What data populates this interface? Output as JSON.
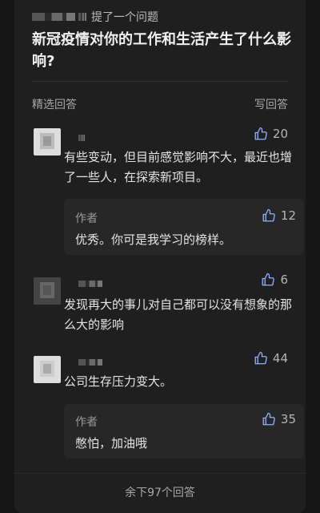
{
  "question": {
    "asker_action": "提了一个问题",
    "title": "新冠疫情对你的工作和生活产生了什么影响?"
  },
  "section": {
    "label": "精选回答",
    "write_answer": "写回答"
  },
  "answers": [
    {
      "likes": "20",
      "text": "有些变动，但目前感觉影响不大，最近也增了一些人，在探索新项目。",
      "reply": {
        "author": "作者",
        "likes": "12",
        "text": "优秀。你可是我学习的榜样。"
      }
    },
    {
      "likes": "6",
      "text": "发现再大的事儿对自己都可以没有想象的那么大的影响"
    },
    {
      "likes": "44",
      "text": "公司生存压力变大。",
      "reply": {
        "author": "作者",
        "likes": "35",
        "text": "憋怕，加油哦"
      }
    }
  ],
  "more_answers": "余下97个回答",
  "icons": {
    "like": "thumbs-up-icon"
  },
  "colors": {
    "background": "#161616",
    "card": "#1f1f1f",
    "reply_box": "#272727"
  }
}
